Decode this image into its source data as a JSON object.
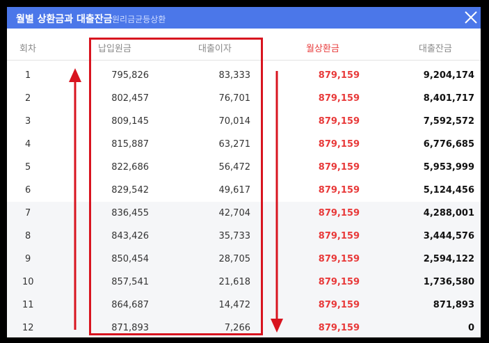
{
  "dialog": {
    "title": "월별 상환금과 대출잔금",
    "subtitle": "원리금균등상환"
  },
  "columns": [
    "회차",
    "납입원금",
    "대출이자",
    "월상환금",
    "대출잔금"
  ],
  "rows": [
    {
      "no": "1",
      "principal": "795,826",
      "interest": "83,333",
      "payment": "879,159",
      "balance": "9,204,174"
    },
    {
      "no": "2",
      "principal": "802,457",
      "interest": "76,701",
      "payment": "879,159",
      "balance": "8,401,717"
    },
    {
      "no": "3",
      "principal": "809,145",
      "interest": "70,014",
      "payment": "879,159",
      "balance": "7,592,572"
    },
    {
      "no": "4",
      "principal": "815,887",
      "interest": "63,271",
      "payment": "879,159",
      "balance": "6,776,685"
    },
    {
      "no": "5",
      "principal": "822,686",
      "interest": "56,472",
      "payment": "879,159",
      "balance": "5,953,999"
    },
    {
      "no": "6",
      "principal": "829,542",
      "interest": "49,617",
      "payment": "879,159",
      "balance": "5,124,456"
    },
    {
      "no": "7",
      "principal": "836,455",
      "interest": "42,704",
      "payment": "879,159",
      "balance": "4,288,001"
    },
    {
      "no": "8",
      "principal": "843,426",
      "interest": "35,733",
      "payment": "879,159",
      "balance": "3,444,576"
    },
    {
      "no": "9",
      "principal": "850,454",
      "interest": "28,705",
      "payment": "879,159",
      "balance": "2,594,122"
    },
    {
      "no": "10",
      "principal": "857,541",
      "interest": "21,618",
      "payment": "879,159",
      "balance": "1,736,580"
    },
    {
      "no": "11",
      "principal": "864,687",
      "interest": "14,472",
      "payment": "879,159",
      "balance": "871,893"
    },
    {
      "no": "12",
      "principal": "871,893",
      "interest": "7,266",
      "payment": "879,159",
      "balance": "0"
    }
  ],
  "colors": {
    "titlebar": "#4b77e9",
    "payment_text": "#e83a3a",
    "annotation": "#d8141f"
  },
  "icons": {
    "close": "close-icon",
    "annotation_up": "arrow-up-icon",
    "annotation_down": "arrow-down-icon"
  }
}
